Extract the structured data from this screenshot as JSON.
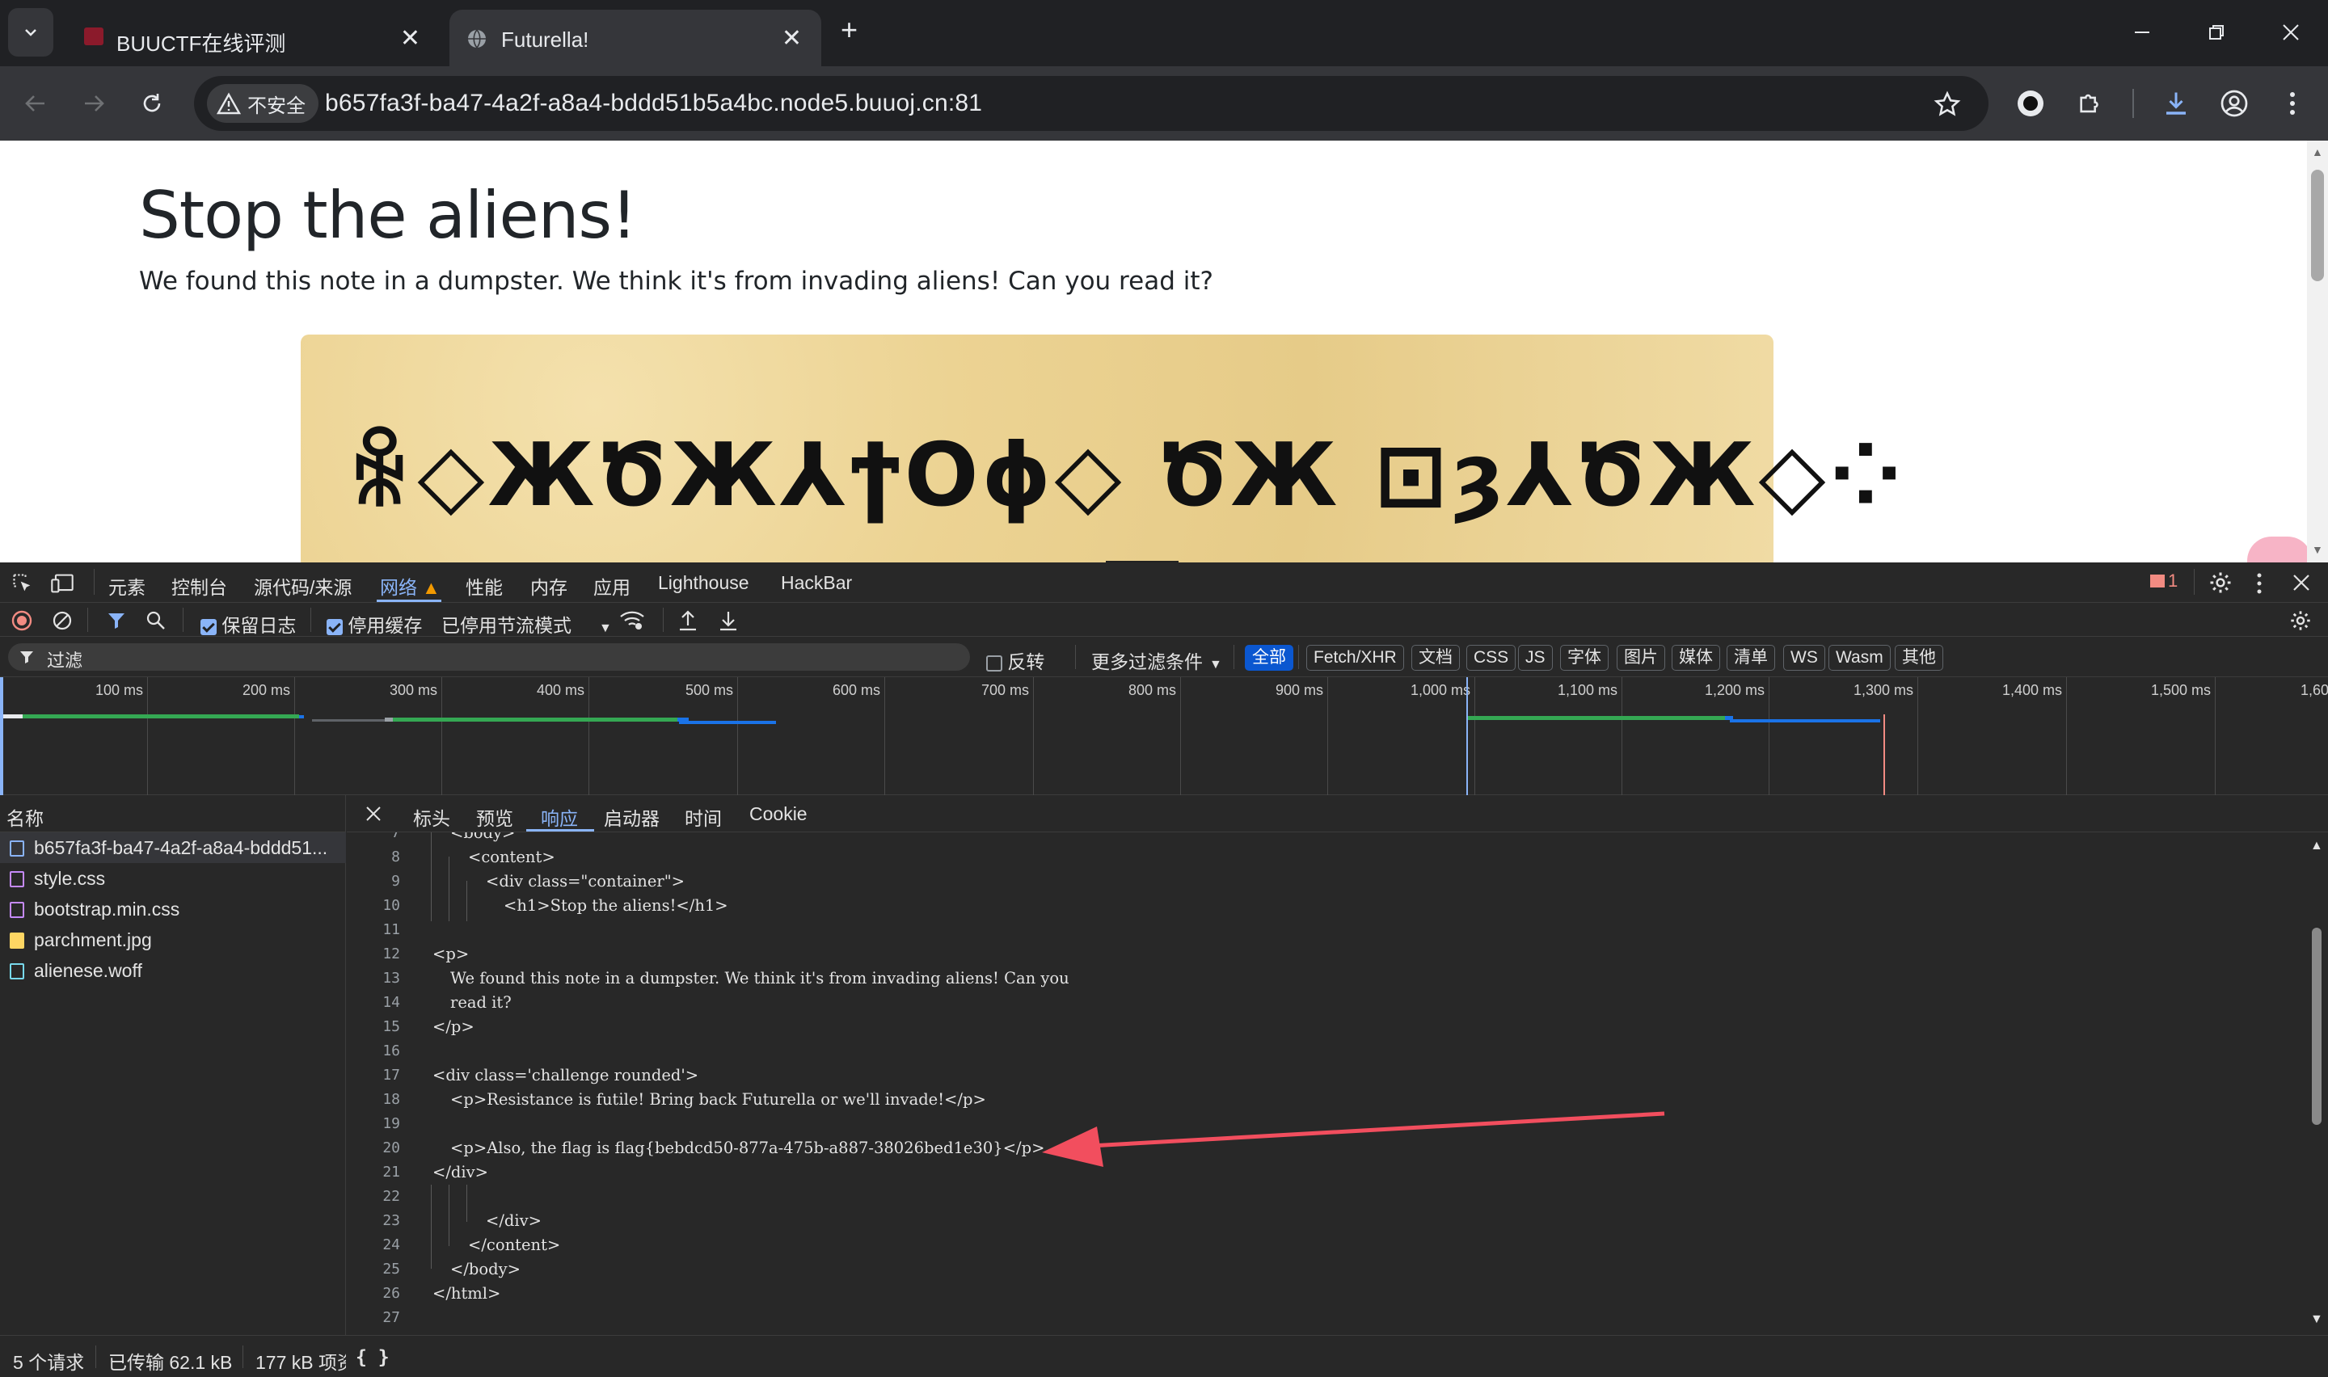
{
  "browser": {
    "tabs": [
      {
        "title": "BUUCTF在线评测",
        "active": false
      },
      {
        "title": "Futurella!",
        "active": true
      }
    ],
    "security_label": "不安全",
    "url": "b657fa3f-ba47-4a2f-a8a4-bddd51b5a4bc.node5.buuoj.cn:81"
  },
  "page": {
    "heading": "Stop the aliens!",
    "note": "We found this note in a dumpster. We think it's from invading aliens! Can you read it?",
    "alien_glyphs": "ꆜ◇ЖԾЖ⅄ϯОϕ◇ ԾЖ ⊡ȝ⅄ԾЖ◇⁘"
  },
  "devtools": {
    "tabs": [
      "元素",
      "控制台",
      "源代码/来源",
      "网络",
      "性能",
      "内存",
      "应用",
      "Lighthouse",
      "HackBar"
    ],
    "active_tab": "网络",
    "issues_count": "1",
    "options": {
      "preserve_log": "保留日志",
      "disable_cache": "停用缓存",
      "throttling": "已停用节流模式"
    },
    "filter": {
      "placeholder": "过滤",
      "invert": "反转",
      "more_filters": "更多过滤条件",
      "types": [
        "全部",
        "Fetch/XHR",
        "文档",
        "CSS",
        "JS",
        "字体",
        "图片",
        "媒体",
        "清单",
        "WS",
        "Wasm",
        "其他"
      ],
      "active_type": "全部"
    },
    "timeline_ticks": [
      "100 ms",
      "200 ms",
      "300 ms",
      "400 ms",
      "500 ms",
      "600 ms",
      "700 ms",
      "800 ms",
      "900 ms",
      "1,000 ms",
      "1,100 ms",
      "1,200 ms",
      "1,300 ms",
      "1,400 ms",
      "1,500 ms",
      "1,60"
    ],
    "requests_header": "名称",
    "requests": [
      {
        "name": "b657fa3f-ba47-4a2f-a8a4-bddd51...",
        "type": "document",
        "color": "#8ab4f8"
      },
      {
        "name": "style.css",
        "type": "stylesheet",
        "color": "#c58af9"
      },
      {
        "name": "bootstrap.min.css",
        "type": "stylesheet",
        "color": "#c58af9"
      },
      {
        "name": "parchment.jpg",
        "type": "image",
        "color": "#fdd663"
      },
      {
        "name": "alienese.woff",
        "type": "font",
        "color": "#78d9ec"
      }
    ],
    "detail_tabs": [
      "标头",
      "预览",
      "响应",
      "启动器",
      "时间",
      "Cookie"
    ],
    "active_detail_tab": "响应",
    "response_lines": [
      {
        "no": "7",
        "text": "<body>"
      },
      {
        "no": "8",
        "text": "<content>"
      },
      {
        "no": "9",
        "text": "<div class=\"container\">"
      },
      {
        "no": "10",
        "text": "<h1>Stop the aliens!</h1>"
      },
      {
        "no": "11",
        "text": ""
      },
      {
        "no": "12",
        "text": "<p>"
      },
      {
        "no": "13",
        "text": "We found this note in a dumpster. We think it's from invading aliens! Can you"
      },
      {
        "no": "14",
        "text": "read it?"
      },
      {
        "no": "15",
        "text": "</p>"
      },
      {
        "no": "16",
        "text": ""
      },
      {
        "no": "17",
        "text": "<div class='challenge rounded'>"
      },
      {
        "no": "18",
        "text": "<p>Resistance is futile! Bring back Futurella or we'll invade!</p>"
      },
      {
        "no": "19",
        "text": ""
      },
      {
        "no": "20",
        "text": "<p>Also, the flag is flag{bebdcd50-877a-475b-a887-38026bed1e30}</p>"
      },
      {
        "no": "21",
        "text": "</div>"
      },
      {
        "no": "22",
        "text": ""
      },
      {
        "no": "23",
        "text": "</div>"
      },
      {
        "no": "24",
        "text": "</content>"
      },
      {
        "no": "25",
        "text": "</body>"
      },
      {
        "no": "26",
        "text": "</html>"
      },
      {
        "no": "27",
        "text": ""
      }
    ],
    "status": {
      "requests": "5 个请求",
      "transferred": "已传输 62.1 kB",
      "resources": "177 kB 项资",
      "pretty_print": "{ }"
    },
    "accent_color": "#8ab4f8",
    "annotation_arrow_color": "#f24e5e"
  }
}
